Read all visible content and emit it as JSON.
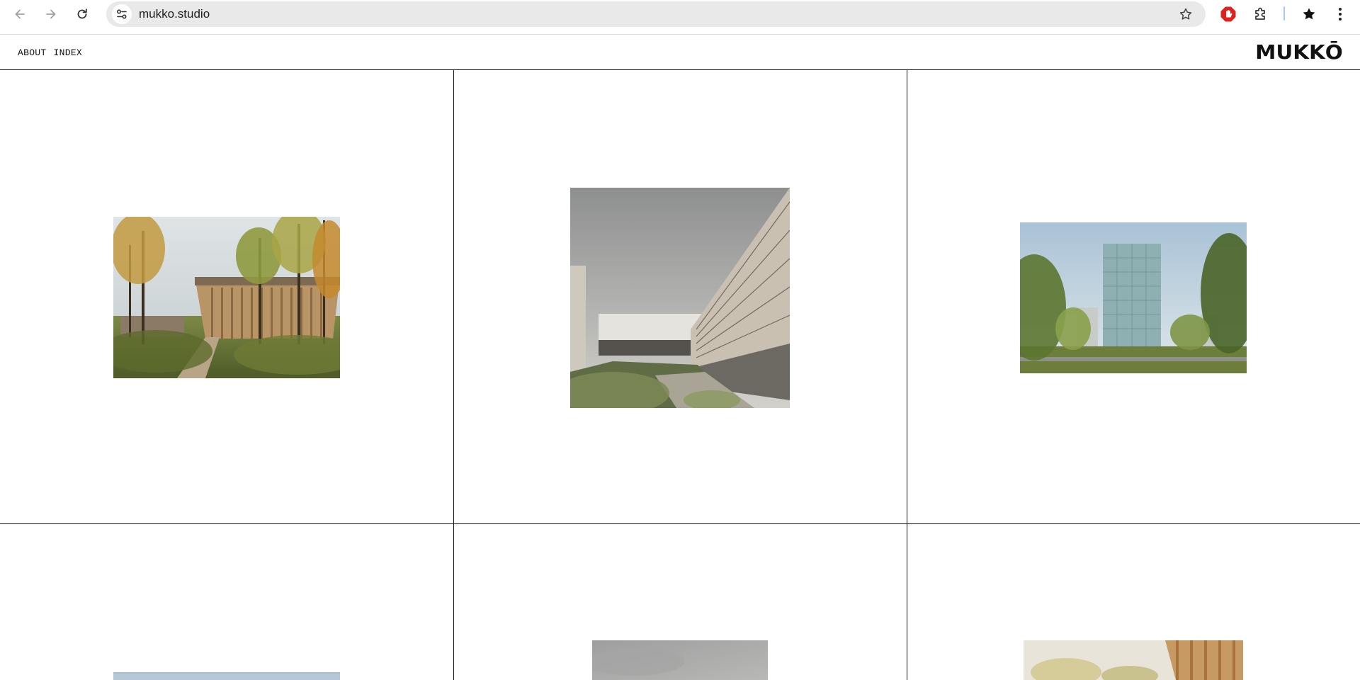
{
  "browser": {
    "url": "mukko.studio",
    "icons": {
      "back": "arrow-left-icon",
      "forward": "arrow-right-icon",
      "reload": "reload-icon",
      "site_info": "tune-icon",
      "bookmark": "star-outline-icon",
      "adblock": "stop-hand-icon",
      "extensions": "puzzle-icon",
      "bookmarks_manager": "star-filled-icon",
      "menu": "kebab-menu-icon"
    },
    "colors": {
      "omnibox": "#e9e9e9",
      "adblock": "#e0201c",
      "divider": "#a8c7fa"
    }
  },
  "site": {
    "nav": [
      {
        "label": "ABOUT"
      },
      {
        "label": "INDEX"
      }
    ],
    "logo_text": "MUKKŌ"
  },
  "projects": [
    {
      "scene": "forest-pavilion",
      "palette": [
        "#c9d2d6",
        "#a47c4e",
        "#6b7a3a",
        "#d2a24a"
      ]
    },
    {
      "scene": "courtyard-building",
      "palette": [
        "#9b9c9c",
        "#cfc9bf",
        "#5d6b47",
        "#8a8a86"
      ]
    },
    {
      "scene": "glass-tower-park",
      "palette": [
        "#bfd3e0",
        "#8fb0b4",
        "#5e7d3a",
        "#8a8d7f"
      ]
    },
    {
      "scene": "sky-partial",
      "palette": [
        "#b6c8d8"
      ]
    },
    {
      "scene": "grey-sky-partial",
      "palette": [
        "#a9aaa9"
      ]
    },
    {
      "scene": "timber-facade-partial",
      "palette": [
        "#e4dfd4",
        "#c28a4d",
        "#b7b16a"
      ]
    }
  ]
}
